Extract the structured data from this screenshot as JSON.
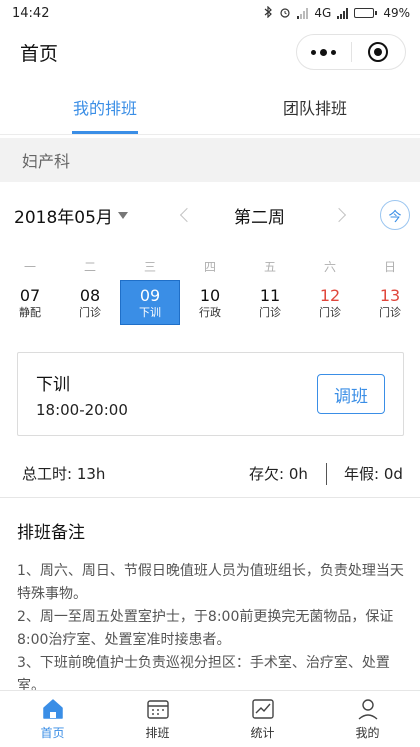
{
  "status_bar": {
    "time": "14:42",
    "network": "4G",
    "battery": "49%",
    "battery_level": 0.49
  },
  "header": {
    "title": "首页"
  },
  "tabs": [
    {
      "label": "我的排班",
      "active": true
    },
    {
      "label": "团队排班",
      "active": false
    }
  ],
  "department": "妇产科",
  "calendar": {
    "month": "2018年05月",
    "week": "第二周",
    "today_label": "今",
    "days": [
      {
        "dow": "一",
        "date": "07",
        "shift": "静配"
      },
      {
        "dow": "二",
        "date": "08",
        "shift": "门诊"
      },
      {
        "dow": "三",
        "date": "09",
        "shift": "下训",
        "selected": true
      },
      {
        "dow": "四",
        "date": "10",
        "shift": "行政"
      },
      {
        "dow": "五",
        "date": "11",
        "shift": "门诊"
      },
      {
        "dow": "六",
        "date": "12",
        "shift": "门诊",
        "weekend": true
      },
      {
        "dow": "日",
        "date": "13",
        "shift": "门诊",
        "weekend": true
      }
    ]
  },
  "shift_card": {
    "name": "下训",
    "time": "18:00-20:00",
    "adjust_label": "调班"
  },
  "stats": {
    "total_hours": "总工时: 13h",
    "owed": "存欠: 0h",
    "annual_leave": "年假: 0d"
  },
  "notes": {
    "title": "排班备注",
    "lines": [
      "1、周六、周日、节假日晚值班人员为值班组长，负责处理当天特殊事物。",
      "2、周一至周五处置室护士，于8:00前更换完无菌物品，保证8:00治疗室、处置室准时接患者。",
      "3、下班前晚值护士负责巡视分担区：手术室、治疗室、处置室。"
    ]
  },
  "bottom_nav": [
    {
      "label": "首页",
      "icon": "home-icon",
      "active": true
    },
    {
      "label": "排班",
      "icon": "schedule-icon"
    },
    {
      "label": "统计",
      "icon": "chart-icon"
    },
    {
      "label": "我的",
      "icon": "profile-icon"
    }
  ],
  "colors": {
    "accent": "#3a8ee6",
    "weekend": "#e0473c"
  }
}
